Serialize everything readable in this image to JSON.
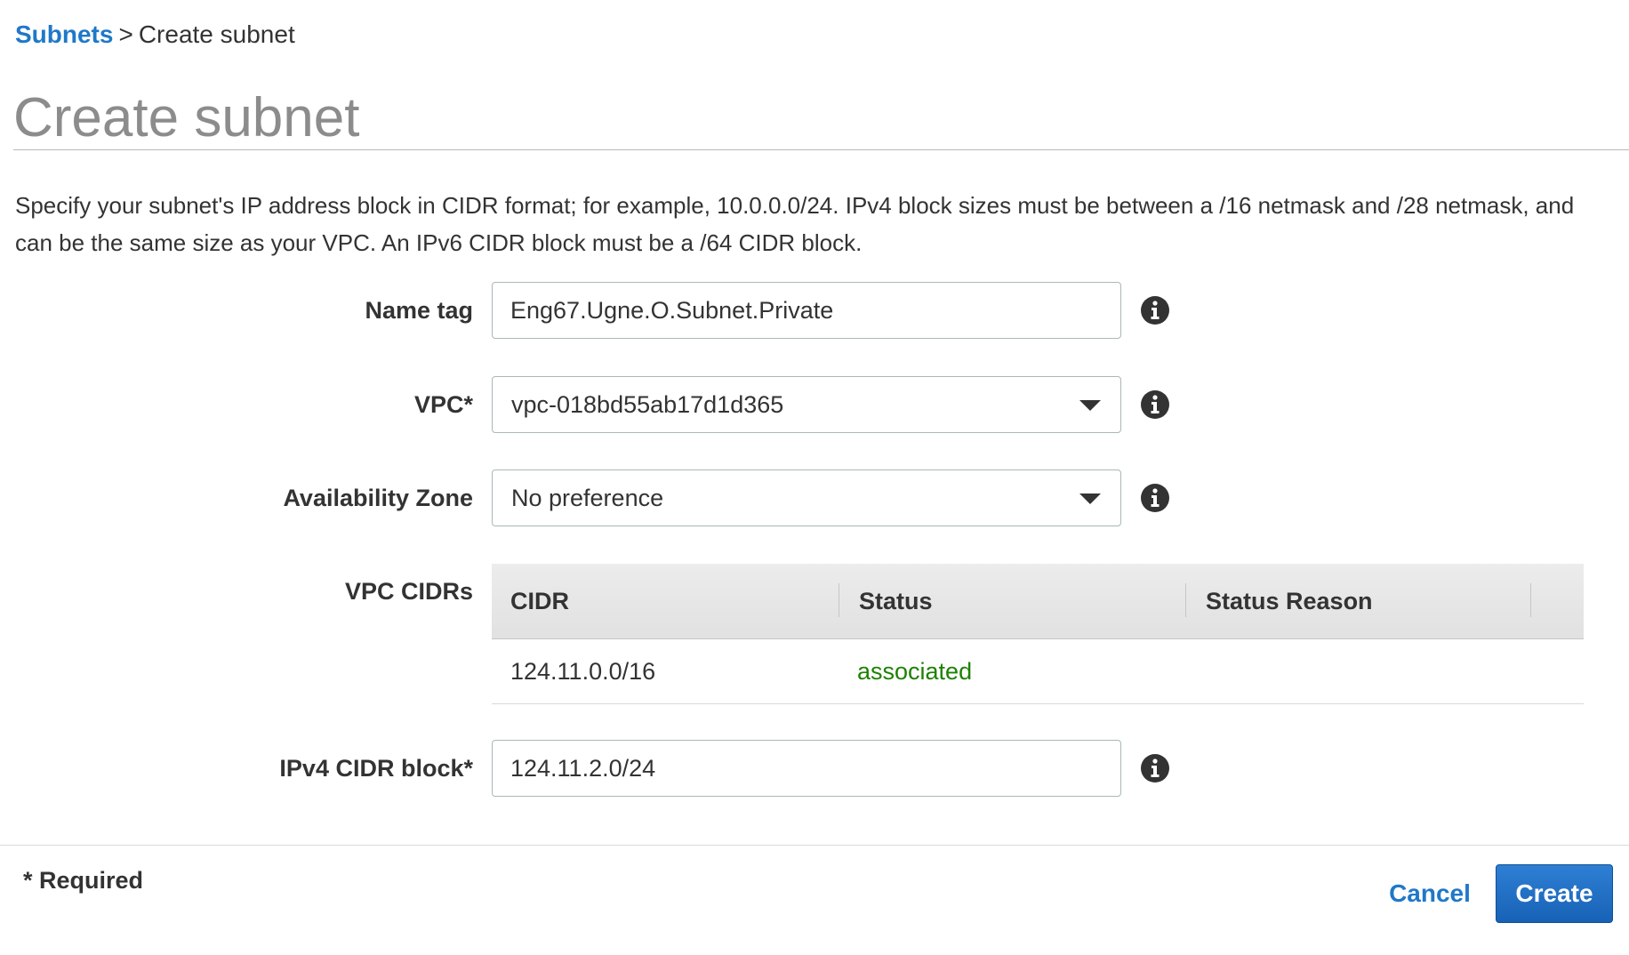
{
  "breadcrumb": {
    "parent": "Subnets",
    "separator": ">",
    "current": "Create subnet"
  },
  "page": {
    "title": "Create subnet",
    "description": "Specify your subnet's IP address block in CIDR format; for example, 10.0.0.0/24. IPv4 block sizes must be between a /16 netmask and /28 netmask, and can be the same size as your VPC. An IPv6 CIDR block must be a /64 CIDR block."
  },
  "form": {
    "name_tag": {
      "label": "Name tag",
      "value": "Eng67.Ugne.O.Subnet.Private"
    },
    "vpc": {
      "label": "VPC*",
      "value": "vpc-018bd55ab17d1d365"
    },
    "availability_zone": {
      "label": "Availability Zone",
      "value": "No preference"
    },
    "vpc_cidrs": {
      "label": "VPC CIDRs",
      "columns": [
        "CIDR",
        "Status",
        "Status Reason"
      ],
      "rows": [
        {
          "cidr": "124.11.0.0/16",
          "status": "associated",
          "status_reason": ""
        }
      ]
    },
    "ipv4_cidr": {
      "label": "IPv4 CIDR block*",
      "value": "124.11.2.0/24"
    }
  },
  "footer": {
    "required_note": "* Required",
    "cancel_label": "Cancel",
    "create_label": "Create"
  },
  "icons": {
    "info": "info-icon",
    "dropdown": "caret-down-icon"
  },
  "colors": {
    "link": "#1f78c8",
    "primary_button": "#1f6fc5",
    "status_associated": "#1d8102",
    "title": "#8c8c8c"
  }
}
